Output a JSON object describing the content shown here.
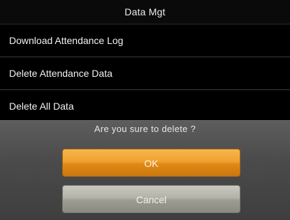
{
  "header": {
    "title": "Data Mgt"
  },
  "menu": {
    "items": [
      {
        "label": "Download Attendance Log"
      },
      {
        "label": "Delete Attendance Data"
      },
      {
        "label": "Delete All Data"
      }
    ]
  },
  "dialog": {
    "message": "Are you sure to delete ?",
    "ok_label": "OK",
    "cancel_label": "Cancel"
  },
  "colors": {
    "ok_button": "#f0a131",
    "cancel_button": "#b3b3a9",
    "dialog_background": "#4b4b4b"
  }
}
